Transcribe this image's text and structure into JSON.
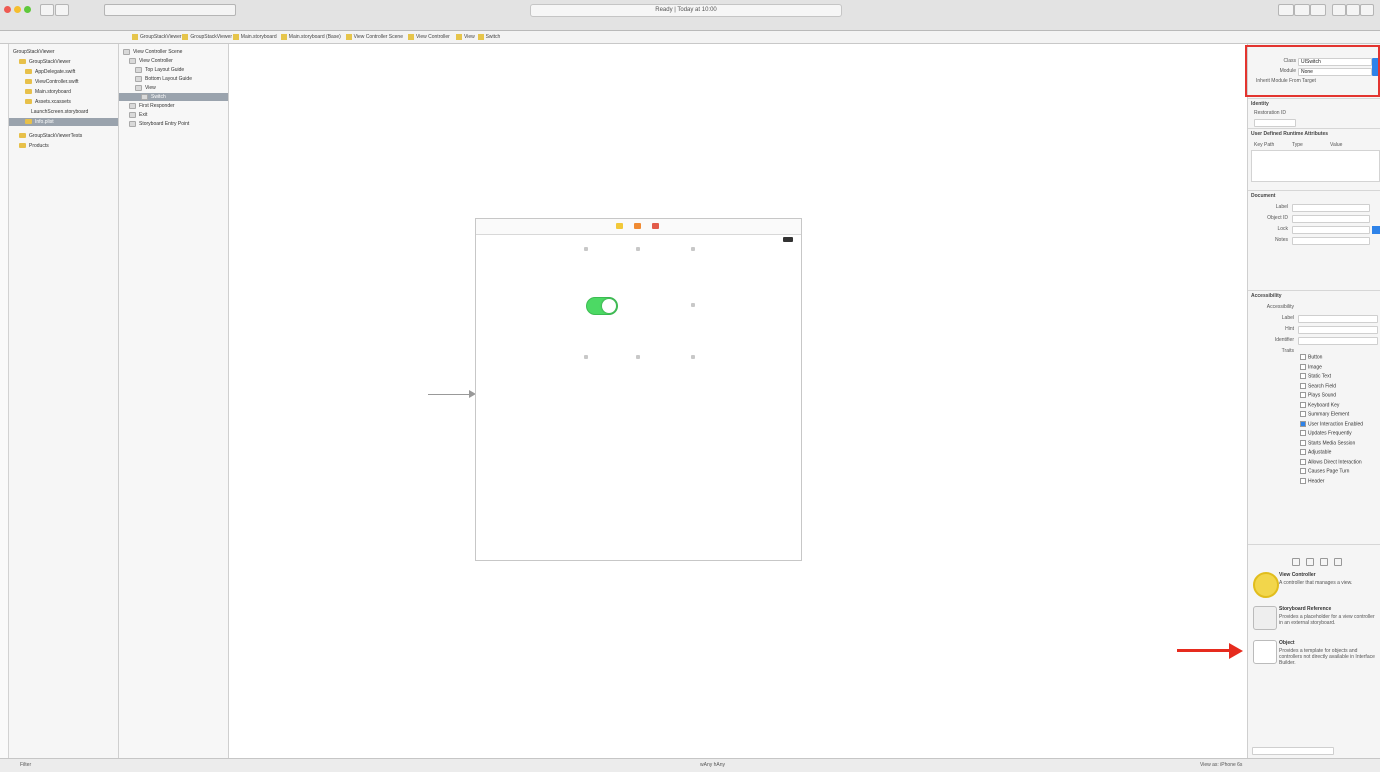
{
  "window": {
    "activity_text": "Ready | Today at 10:00",
    "traffic_colors": [
      "#ee5a52",
      "#f5be2f",
      "#5fc83b"
    ]
  },
  "jumpbar": {
    "crumbs": [
      "GroupStackViewer",
      "GroupStackViewer",
      "Main.storyboard",
      "Main.storyboard (Base)",
      "View Controller Scene",
      "View Controller",
      "View",
      "Switch"
    ]
  },
  "navigator": {
    "items": [
      {
        "label": "GroupStackViewer",
        "level": 0,
        "folder": false
      },
      {
        "label": "GroupStackViewer",
        "level": 1,
        "folder": true
      },
      {
        "label": "AppDelegate.swift",
        "level": 2,
        "folder": true
      },
      {
        "label": "ViewController.swift",
        "level": 2,
        "folder": true
      },
      {
        "label": "Main.storyboard",
        "level": 2,
        "folder": true
      },
      {
        "label": "Assets.xcassets",
        "level": 2,
        "folder": true
      },
      {
        "label": "LaunchScreen.storyboard",
        "level": 3,
        "folder": false
      },
      {
        "label": "Info.plist",
        "level": 2,
        "folder": true,
        "selected": true
      },
      {
        "label": "GroupStackViewerTests",
        "level": 1,
        "folder": true
      },
      {
        "label": "Products",
        "level": 1,
        "folder": true
      }
    ]
  },
  "outline": {
    "items": [
      {
        "label": "View Controller Scene",
        "level": 0
      },
      {
        "label": "View Controller",
        "level": 1
      },
      {
        "label": "Top Layout Guide",
        "level": 2
      },
      {
        "label": "Bottom Layout Guide",
        "level": 2
      },
      {
        "label": "View",
        "level": 2
      },
      {
        "label": "Switch",
        "level": 3,
        "selected": true
      },
      {
        "label": "First Responder",
        "level": 1
      },
      {
        "label": "Exit",
        "level": 1
      },
      {
        "label": "Storyboard Entry Point",
        "level": 1
      }
    ]
  },
  "canvas": {
    "toggle_on": true,
    "toggle_color": "#4cd964"
  },
  "inspector": {
    "header_rows": [
      {
        "label": "Class",
        "value": "UISwitch"
      },
      {
        "label": "Module",
        "value": "None"
      },
      {
        "label": "Inherit Module From Target",
        "value": ""
      }
    ],
    "sections": {
      "identity": "Identity",
      "restoration": "Restoration ID",
      "document": "User Defined Runtime Attributes",
      "table_headers": [
        "Key Path",
        "Type",
        "Value"
      ],
      "document2": "Document",
      "accessibility": "Accessibility"
    },
    "document_rows": [
      "Label",
      "Object ID",
      "Lock",
      "Notes"
    ],
    "accessibility_rows": [
      "Accessibility",
      "Label",
      "Hint",
      "Identifier",
      "Traits"
    ],
    "traits": [
      "Button",
      "Image",
      "Static Text",
      "Search Field",
      "Plays Sound",
      "Keyboard Key",
      "Summary Element",
      "User Interaction Enabled",
      "Updates Frequently",
      "Starts Media Session",
      "Adjustable",
      "Allows Direct Interaction",
      "Causes Page Turn",
      "Header"
    ],
    "library_items": [
      {
        "title": "View Controller",
        "desc": "A controller that manages a view.",
        "color": "#f2d64b"
      },
      {
        "title": "Storyboard Reference",
        "desc": "Provides a placeholder for a view controller in an external storyboard.",
        "color": "#eeeeee"
      },
      {
        "title": "Object",
        "desc": "Provides a template for objects and controllers not directly available in Interface Builder.",
        "color": "#ffffff"
      }
    ],
    "highlight_color": "#e3342f",
    "arrow_color": "#e62b1e"
  },
  "status": {
    "left": "Filter",
    "center": "wAny hAny",
    "right": "View as: iPhone 6s"
  }
}
